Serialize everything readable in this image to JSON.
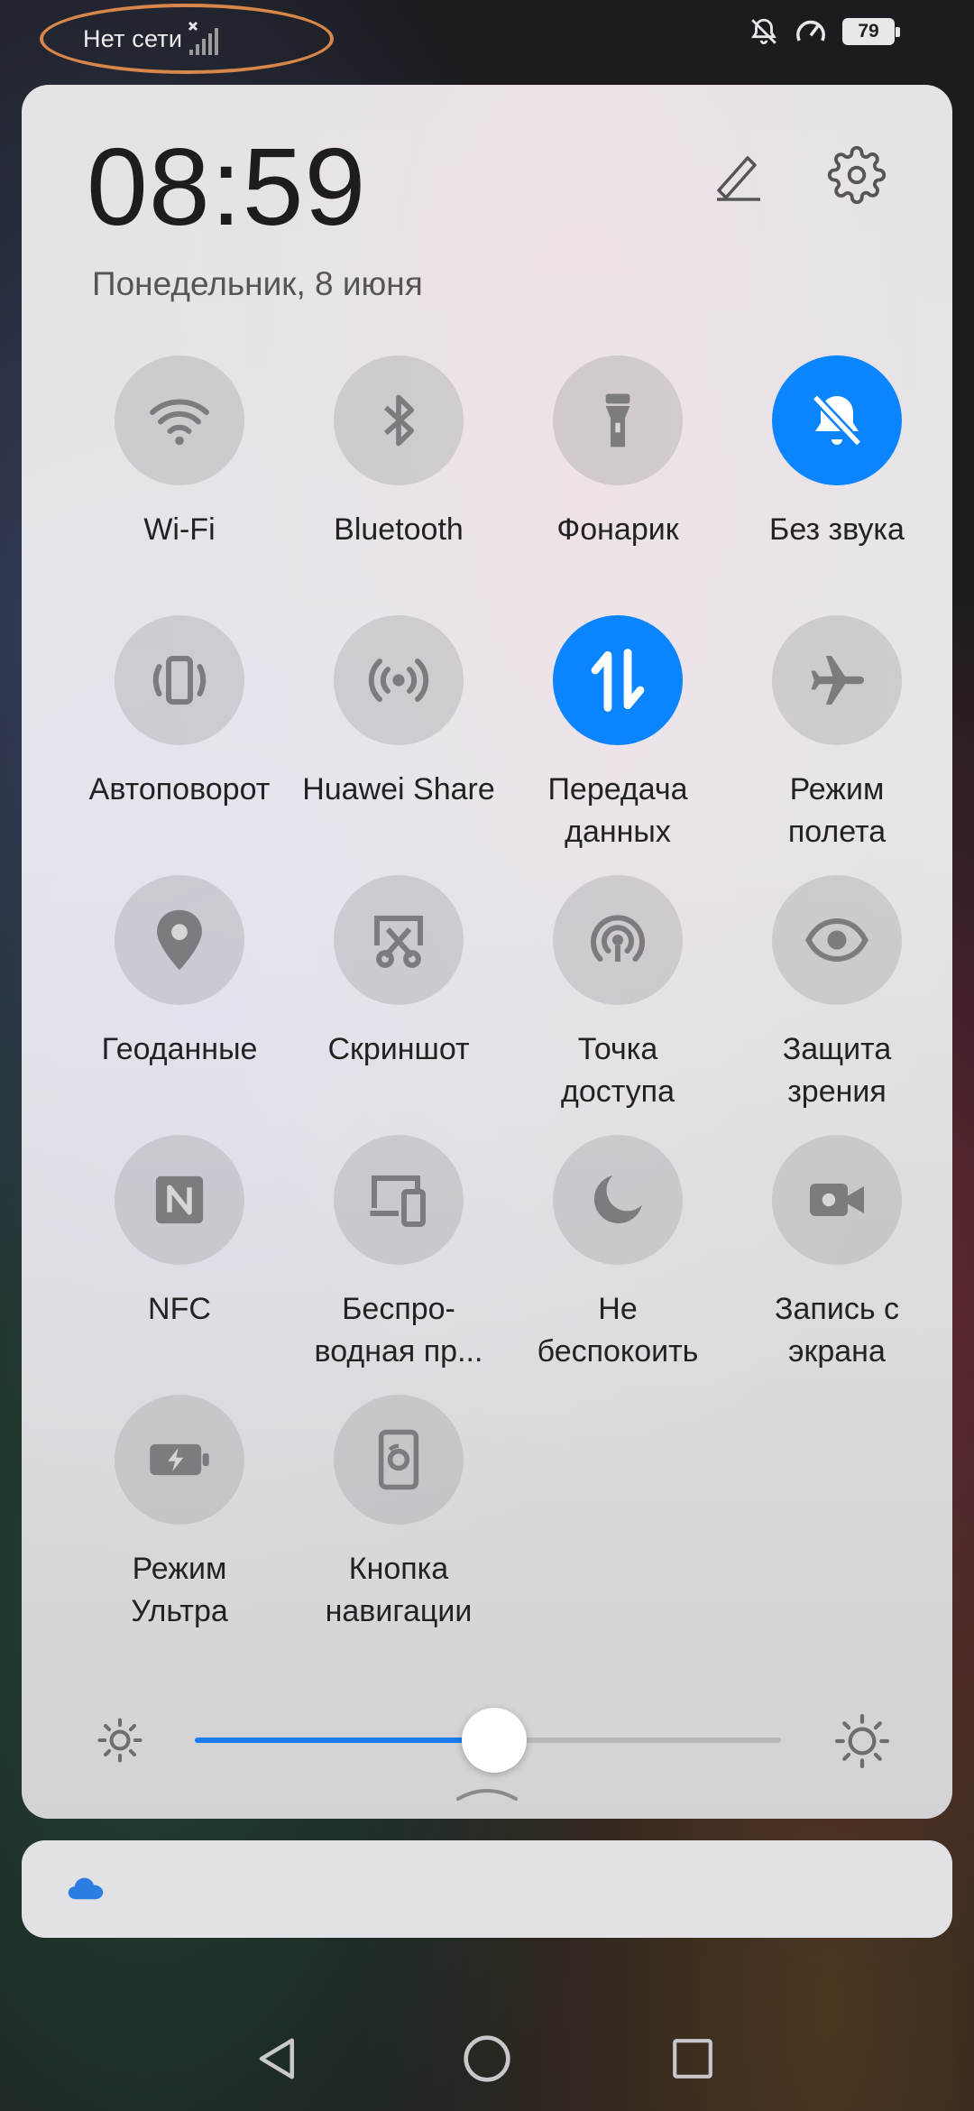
{
  "status_bar": {
    "carrier": "Нет сети",
    "battery": "79",
    "icons": [
      "signal-no-service-icon",
      "bell-off-icon",
      "speed-meter-icon",
      "battery-icon"
    ]
  },
  "header": {
    "time": "08:59",
    "date": "Понедельник, 8 июня",
    "icons": [
      "edit-pencil-icon",
      "settings-gear-icon"
    ]
  },
  "tiles": [
    {
      "label": "Wi-Fi",
      "icon": "wifi-icon",
      "active": false
    },
    {
      "label": "Bluetooth",
      "icon": "bluetooth-icon",
      "active": false
    },
    {
      "label": "Фонарик",
      "icon": "flashlight-icon",
      "active": false
    },
    {
      "label": "Без звука",
      "icon": "bell-off-icon",
      "active": true
    },
    {
      "label": "Автоповорот",
      "icon": "auto-rotate-icon",
      "active": false
    },
    {
      "label": "Huawei Share",
      "icon": "huawei-share-icon",
      "active": false
    },
    {
      "label_lines": [
        "Передача",
        "данных"
      ],
      "icon": "data-transfer-icon",
      "active": true
    },
    {
      "label_lines": [
        "Режим",
        "полета"
      ],
      "icon": "airplane-icon",
      "active": false
    },
    {
      "label": "Геоданные",
      "icon": "location-pin-icon",
      "active": false
    },
    {
      "label": "Скриншот",
      "icon": "screenshot-icon",
      "active": false
    },
    {
      "label_lines": [
        "Точка",
        "доступа"
      ],
      "icon": "hotspot-icon",
      "active": false
    },
    {
      "label_lines": [
        "Защита",
        "зрения"
      ],
      "icon": "eye-icon",
      "active": false
    },
    {
      "label": "NFC",
      "icon": "nfc-icon",
      "active": false
    },
    {
      "label_lines": [
        "Беспро-",
        "водная пр..."
      ],
      "icon": "wireless-projection-icon",
      "active": false
    },
    {
      "label_lines": [
        "Не",
        "беспокоить"
      ],
      "icon": "moon-icon",
      "active": false
    },
    {
      "label_lines": [
        "Запись с",
        "экрана"
      ],
      "icon": "screen-record-icon",
      "active": false
    },
    {
      "label_lines": [
        "Режим",
        "Ультра"
      ],
      "icon": "battery-bolt-icon",
      "active": false
    },
    {
      "label_lines": [
        "Кнопка",
        "навигации"
      ],
      "icon": "navigation-button-icon",
      "active": false
    }
  ],
  "brightness": {
    "level": 0.51,
    "accent": "#1a7cf0",
    "icons": [
      "sun-small-icon",
      "sun-large-icon"
    ]
  },
  "colors": {
    "active_tile": "#0a84ff",
    "carrier_highlight": "#d8874a"
  },
  "notification_card": {
    "icon": "cloud-icon"
  },
  "nav_bar": {
    "icons": [
      "back-triangle-icon",
      "home-circle-icon",
      "recent-square-icon"
    ]
  }
}
